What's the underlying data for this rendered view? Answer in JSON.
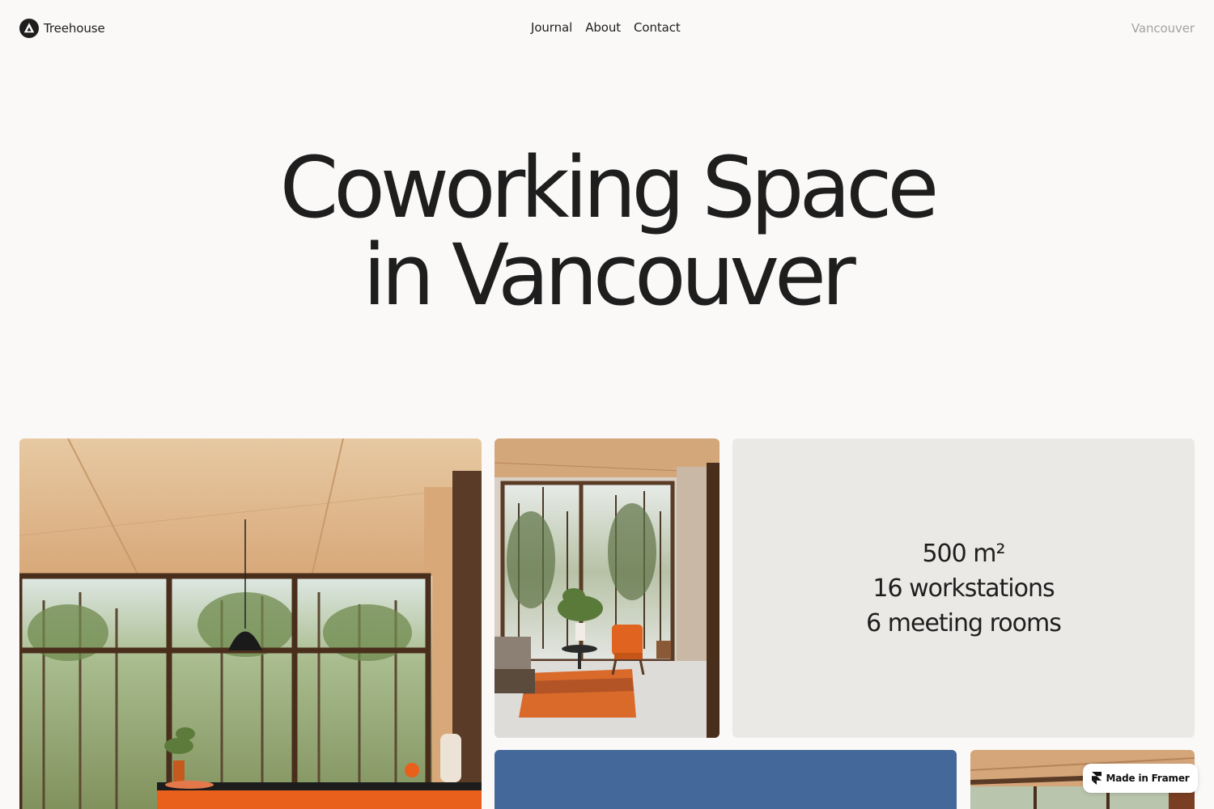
{
  "header": {
    "brand_name": "Treehouse",
    "logo_icon": "triangle-in-circle-icon",
    "nav": [
      {
        "label": "Journal"
      },
      {
        "label": "About"
      },
      {
        "label": "Contact"
      }
    ],
    "location": "Vancouver"
  },
  "hero": {
    "title_line1": "Coworking Space",
    "title_line2": "in Vancouver"
  },
  "stats": [
    {
      "text": "500 m²"
    },
    {
      "text": "16 workstations"
    },
    {
      "text": "6 meeting rooms"
    }
  ],
  "badge": {
    "label": "Made in Framer",
    "icon": "framer-icon"
  },
  "colors": {
    "background": "#faf9f7",
    "text": "#1e1e1e",
    "muted_text": "#a3a3a3",
    "stats_tile": "#ebe9e6",
    "blue_tile": "#44689a",
    "accent_orange": "#e8601c"
  }
}
